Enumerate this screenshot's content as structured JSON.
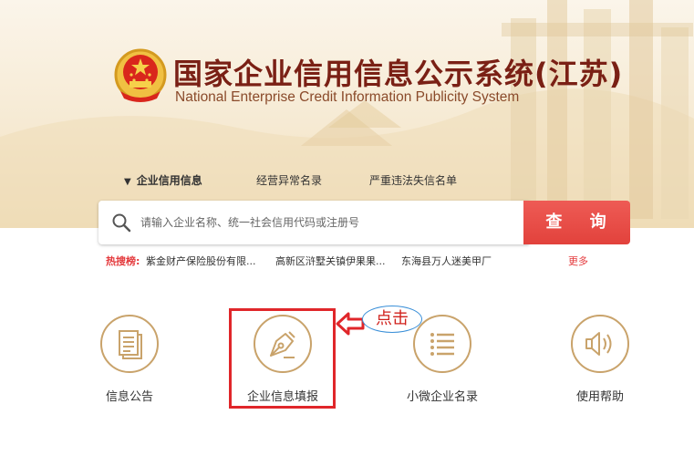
{
  "header": {
    "title_cn": "国家企业信用信息公示系统(江苏)",
    "title_en": "National Enterprise Credit Information Publicity System"
  },
  "tabs": [
    {
      "label": "企业信用信息",
      "active": true
    },
    {
      "label": "经营异常名录",
      "active": false
    },
    {
      "label": "严重违法失信名单",
      "active": false
    }
  ],
  "search": {
    "placeholder": "请输入企业名称、统一社会信用代码或注册号",
    "value": "",
    "button_label": "查 询"
  },
  "hot_search": {
    "label": "热搜榜:",
    "items": [
      "紫金财产保险股份有限...",
      "高新区浒墅关镇伊果果...",
      "东海县万人迷美甲厂"
    ],
    "more_label": "更多"
  },
  "features": [
    {
      "label": "信息公告",
      "icon": "document-icon"
    },
    {
      "label": "企业信息填报",
      "icon": "pen-nib-icon"
    },
    {
      "label": "小微企业名录",
      "icon": "list-icon"
    },
    {
      "label": "使用帮助",
      "icon": "speaker-icon"
    }
  ],
  "annotation": {
    "callout_text": "点击",
    "highlight_color": "#e0262a"
  },
  "colors": {
    "brand": "#7a2015",
    "search_button": "#e2423c",
    "icon_gold": "#c9a36b",
    "hot_red": "#e4393c"
  }
}
